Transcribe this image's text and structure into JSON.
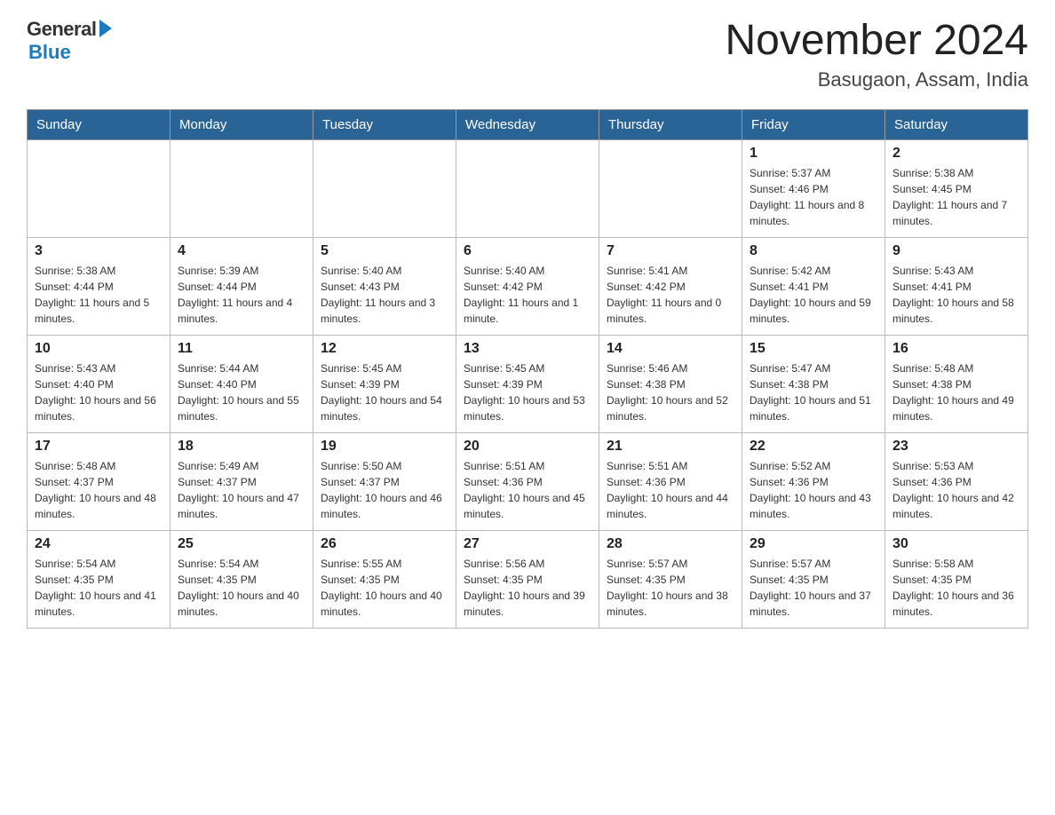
{
  "header": {
    "logo_general": "General",
    "logo_blue": "Blue",
    "month_title": "November 2024",
    "location": "Basugaon, Assam, India"
  },
  "weekdays": [
    "Sunday",
    "Monday",
    "Tuesday",
    "Wednesday",
    "Thursday",
    "Friday",
    "Saturday"
  ],
  "rows": [
    {
      "cells": [
        {
          "day": "",
          "sunrise": "",
          "sunset": "",
          "daylight": ""
        },
        {
          "day": "",
          "sunrise": "",
          "sunset": "",
          "daylight": ""
        },
        {
          "day": "",
          "sunrise": "",
          "sunset": "",
          "daylight": ""
        },
        {
          "day": "",
          "sunrise": "",
          "sunset": "",
          "daylight": ""
        },
        {
          "day": "",
          "sunrise": "",
          "sunset": "",
          "daylight": ""
        },
        {
          "day": "1",
          "sunrise": "Sunrise: 5:37 AM",
          "sunset": "Sunset: 4:46 PM",
          "daylight": "Daylight: 11 hours and 8 minutes."
        },
        {
          "day": "2",
          "sunrise": "Sunrise: 5:38 AM",
          "sunset": "Sunset: 4:45 PM",
          "daylight": "Daylight: 11 hours and 7 minutes."
        }
      ]
    },
    {
      "cells": [
        {
          "day": "3",
          "sunrise": "Sunrise: 5:38 AM",
          "sunset": "Sunset: 4:44 PM",
          "daylight": "Daylight: 11 hours and 5 minutes."
        },
        {
          "day": "4",
          "sunrise": "Sunrise: 5:39 AM",
          "sunset": "Sunset: 4:44 PM",
          "daylight": "Daylight: 11 hours and 4 minutes."
        },
        {
          "day": "5",
          "sunrise": "Sunrise: 5:40 AM",
          "sunset": "Sunset: 4:43 PM",
          "daylight": "Daylight: 11 hours and 3 minutes."
        },
        {
          "day": "6",
          "sunrise": "Sunrise: 5:40 AM",
          "sunset": "Sunset: 4:42 PM",
          "daylight": "Daylight: 11 hours and 1 minute."
        },
        {
          "day": "7",
          "sunrise": "Sunrise: 5:41 AM",
          "sunset": "Sunset: 4:42 PM",
          "daylight": "Daylight: 11 hours and 0 minutes."
        },
        {
          "day": "8",
          "sunrise": "Sunrise: 5:42 AM",
          "sunset": "Sunset: 4:41 PM",
          "daylight": "Daylight: 10 hours and 59 minutes."
        },
        {
          "day": "9",
          "sunrise": "Sunrise: 5:43 AM",
          "sunset": "Sunset: 4:41 PM",
          "daylight": "Daylight: 10 hours and 58 minutes."
        }
      ]
    },
    {
      "cells": [
        {
          "day": "10",
          "sunrise": "Sunrise: 5:43 AM",
          "sunset": "Sunset: 4:40 PM",
          "daylight": "Daylight: 10 hours and 56 minutes."
        },
        {
          "day": "11",
          "sunrise": "Sunrise: 5:44 AM",
          "sunset": "Sunset: 4:40 PM",
          "daylight": "Daylight: 10 hours and 55 minutes."
        },
        {
          "day": "12",
          "sunrise": "Sunrise: 5:45 AM",
          "sunset": "Sunset: 4:39 PM",
          "daylight": "Daylight: 10 hours and 54 minutes."
        },
        {
          "day": "13",
          "sunrise": "Sunrise: 5:45 AM",
          "sunset": "Sunset: 4:39 PM",
          "daylight": "Daylight: 10 hours and 53 minutes."
        },
        {
          "day": "14",
          "sunrise": "Sunrise: 5:46 AM",
          "sunset": "Sunset: 4:38 PM",
          "daylight": "Daylight: 10 hours and 52 minutes."
        },
        {
          "day": "15",
          "sunrise": "Sunrise: 5:47 AM",
          "sunset": "Sunset: 4:38 PM",
          "daylight": "Daylight: 10 hours and 51 minutes."
        },
        {
          "day": "16",
          "sunrise": "Sunrise: 5:48 AM",
          "sunset": "Sunset: 4:38 PM",
          "daylight": "Daylight: 10 hours and 49 minutes."
        }
      ]
    },
    {
      "cells": [
        {
          "day": "17",
          "sunrise": "Sunrise: 5:48 AM",
          "sunset": "Sunset: 4:37 PM",
          "daylight": "Daylight: 10 hours and 48 minutes."
        },
        {
          "day": "18",
          "sunrise": "Sunrise: 5:49 AM",
          "sunset": "Sunset: 4:37 PM",
          "daylight": "Daylight: 10 hours and 47 minutes."
        },
        {
          "day": "19",
          "sunrise": "Sunrise: 5:50 AM",
          "sunset": "Sunset: 4:37 PM",
          "daylight": "Daylight: 10 hours and 46 minutes."
        },
        {
          "day": "20",
          "sunrise": "Sunrise: 5:51 AM",
          "sunset": "Sunset: 4:36 PM",
          "daylight": "Daylight: 10 hours and 45 minutes."
        },
        {
          "day": "21",
          "sunrise": "Sunrise: 5:51 AM",
          "sunset": "Sunset: 4:36 PM",
          "daylight": "Daylight: 10 hours and 44 minutes."
        },
        {
          "day": "22",
          "sunrise": "Sunrise: 5:52 AM",
          "sunset": "Sunset: 4:36 PM",
          "daylight": "Daylight: 10 hours and 43 minutes."
        },
        {
          "day": "23",
          "sunrise": "Sunrise: 5:53 AM",
          "sunset": "Sunset: 4:36 PM",
          "daylight": "Daylight: 10 hours and 42 minutes."
        }
      ]
    },
    {
      "cells": [
        {
          "day": "24",
          "sunrise": "Sunrise: 5:54 AM",
          "sunset": "Sunset: 4:35 PM",
          "daylight": "Daylight: 10 hours and 41 minutes."
        },
        {
          "day": "25",
          "sunrise": "Sunrise: 5:54 AM",
          "sunset": "Sunset: 4:35 PM",
          "daylight": "Daylight: 10 hours and 40 minutes."
        },
        {
          "day": "26",
          "sunrise": "Sunrise: 5:55 AM",
          "sunset": "Sunset: 4:35 PM",
          "daylight": "Daylight: 10 hours and 40 minutes."
        },
        {
          "day": "27",
          "sunrise": "Sunrise: 5:56 AM",
          "sunset": "Sunset: 4:35 PM",
          "daylight": "Daylight: 10 hours and 39 minutes."
        },
        {
          "day": "28",
          "sunrise": "Sunrise: 5:57 AM",
          "sunset": "Sunset: 4:35 PM",
          "daylight": "Daylight: 10 hours and 38 minutes."
        },
        {
          "day": "29",
          "sunrise": "Sunrise: 5:57 AM",
          "sunset": "Sunset: 4:35 PM",
          "daylight": "Daylight: 10 hours and 37 minutes."
        },
        {
          "day": "30",
          "sunrise": "Sunrise: 5:58 AM",
          "sunset": "Sunset: 4:35 PM",
          "daylight": "Daylight: 10 hours and 36 minutes."
        }
      ]
    }
  ]
}
